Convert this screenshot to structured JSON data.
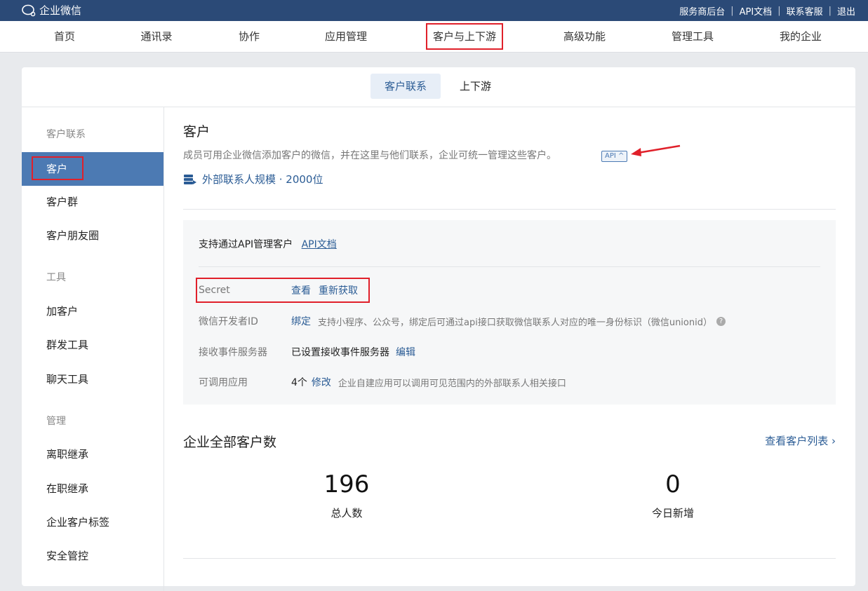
{
  "topbar": {
    "brand": "企业微信",
    "links": [
      "服务商后台",
      "API文档",
      "联系客服",
      "退出"
    ]
  },
  "mainnav": {
    "items": [
      "首页",
      "通讯录",
      "协作",
      "应用管理",
      "客户与上下游",
      "高级功能",
      "管理工具",
      "我的企业"
    ],
    "active": "客户与上下游"
  },
  "subtabs": [
    "客户联系",
    "上下游"
  ],
  "sidebar": {
    "groups": [
      "客户联系",
      "工具",
      "管理"
    ],
    "items": {
      "kehu": "客户",
      "kehuqun": "客户群",
      "pengyouquan": "客户朋友圈",
      "jiakehu": "加客户",
      "qunfa": "群发工具",
      "liaotian": "聊天工具",
      "lizhi": "离职继承",
      "zaizhi": "在职继承",
      "biaoqian": "企业客户标签",
      "anquan": "安全管控"
    }
  },
  "content": {
    "title": "客户",
    "desc": "成员可用企业微信添加客户的微信，并在这里与他们联系，企业可统一管理这些客户。",
    "api_badge": "API ^",
    "scale": "外部联系人规模 · 2000位",
    "api": {
      "head": "支持通过API管理客户",
      "doc_link": "API文档",
      "secret_label": "Secret",
      "secret_view": "查看",
      "secret_refresh": "重新获取",
      "devid_label": "微信开发者ID",
      "devid_bind": "绑定",
      "devid_note": "支持小程序、公众号，绑定后可通过api接口获取微信联系人对应的唯一身份标识（微信unionid）",
      "event_label": "接收事件服务器",
      "event_val": "已设置接收事件服务器",
      "event_edit": "编辑",
      "apps_label": "可调用应用",
      "apps_val": "4个",
      "apps_edit": "修改",
      "apps_note": "企业自建应用可以调用可见范围内的外部联系人相关接口"
    },
    "stats": {
      "title": "企业全部客户数",
      "link": "查看客户列表 ›",
      "total_num": "196",
      "total_label": "总人数",
      "today_num": "0",
      "today_label": "今日新增"
    }
  },
  "colors": {
    "topbar": "#2b4a77",
    "accent": "#4c7ab3",
    "link": "#2b5c95",
    "highlight": "#e0202a"
  }
}
